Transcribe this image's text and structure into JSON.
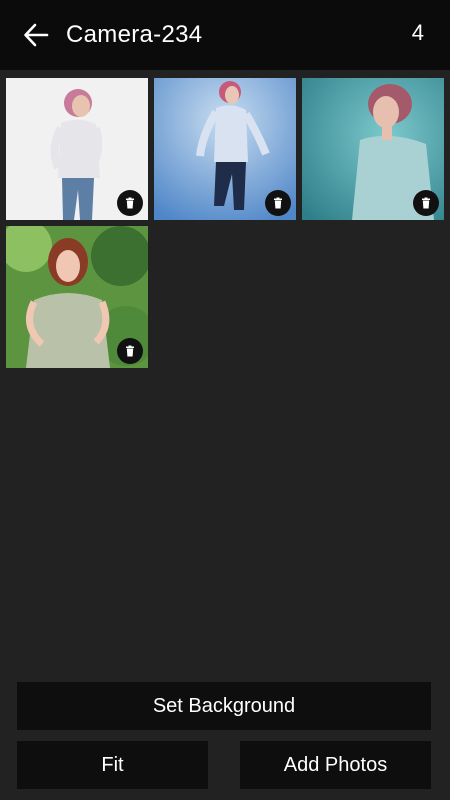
{
  "header": {
    "title": "Camera-234",
    "count": "4",
    "back_icon": "arrow-left-icon"
  },
  "photos": [
    {
      "subject": "woman-white-shirt",
      "bg": "#f1f1f1"
    },
    {
      "subject": "woman-walking-blue-bg",
      "bg": "#8ab6dc"
    },
    {
      "subject": "woman-profile-teal-bg",
      "bg": "#4aa4aa"
    },
    {
      "subject": "woman-floral-dress-outdoor",
      "bg": "#4f8a3a"
    }
  ],
  "delete_icon": "trash-icon",
  "actions": {
    "set_background": "Set Background",
    "fit": "Fit",
    "add_photos": "Add Photos"
  }
}
